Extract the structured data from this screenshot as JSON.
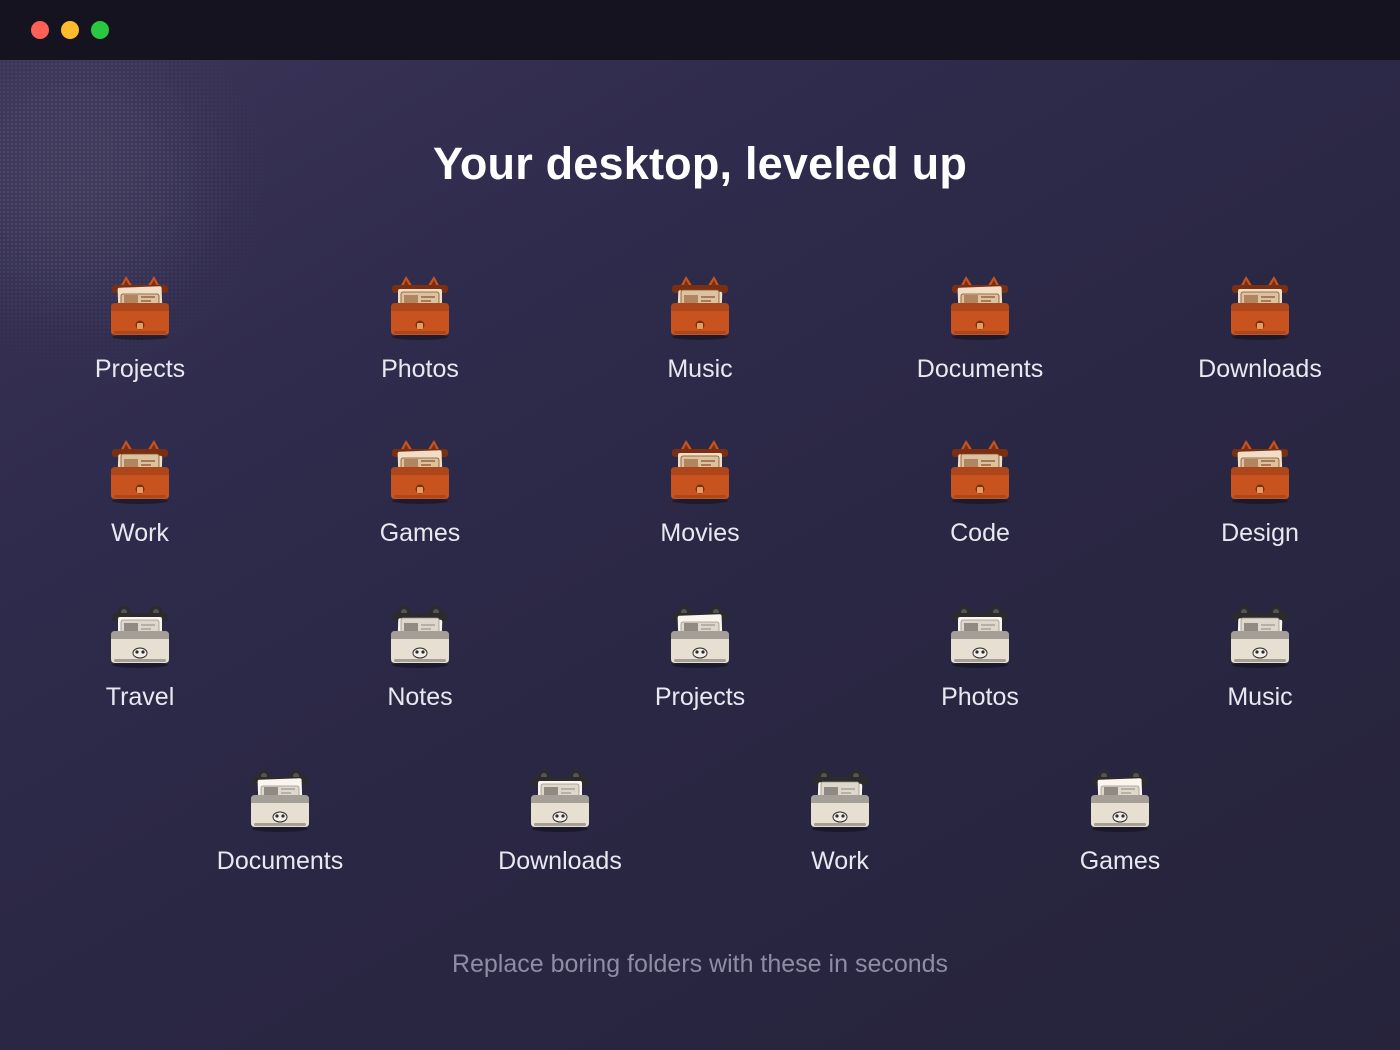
{
  "window": {
    "controls": [
      {
        "name": "close",
        "color": "#fe5f57"
      },
      {
        "name": "minimize",
        "color": "#febb2e"
      },
      {
        "name": "maximize",
        "color": "#28c840"
      }
    ]
  },
  "headline": "Your desktop, leveled up",
  "subtitle": "Replace boring folders with these in seconds",
  "palette": {
    "fox": {
      "body": "#c8531f",
      "dark": "#7a2f12",
      "paper": "#f0dfc6",
      "accent": "#8a4a24"
    },
    "panda": {
      "body": "#e6dfd2",
      "dark": "#2c2b2b",
      "paper": "#faf6ee",
      "accent": "#9b948a"
    }
  },
  "rows": [
    [
      {
        "label": "Projects",
        "icon": "fox-folder-icon",
        "theme": "fox"
      },
      {
        "label": "Photos",
        "icon": "fox-folder-icon",
        "theme": "fox"
      },
      {
        "label": "Music",
        "icon": "fox-folder-icon",
        "theme": "fox"
      },
      {
        "label": "Documents",
        "icon": "fox-folder-icon",
        "theme": "fox"
      },
      {
        "label": "Downloads",
        "icon": "fox-folder-icon",
        "theme": "fox"
      }
    ],
    [
      {
        "label": "Work",
        "icon": "fox-folder-icon",
        "theme": "fox"
      },
      {
        "label": "Games",
        "icon": "fox-folder-icon",
        "theme": "fox"
      },
      {
        "label": "Movies",
        "icon": "fox-folder-icon",
        "theme": "fox"
      },
      {
        "label": "Code",
        "icon": "fox-folder-icon",
        "theme": "fox"
      },
      {
        "label": "Design",
        "icon": "fox-folder-icon",
        "theme": "fox"
      }
    ],
    [
      {
        "label": "Travel",
        "icon": "panda-folder-icon",
        "theme": "panda"
      },
      {
        "label": "Notes",
        "icon": "panda-folder-icon",
        "theme": "panda"
      },
      {
        "label": "Projects",
        "icon": "panda-folder-icon",
        "theme": "panda"
      },
      {
        "label": "Photos",
        "icon": "panda-folder-icon",
        "theme": "panda"
      },
      {
        "label": "Music",
        "icon": "panda-folder-icon",
        "theme": "panda"
      }
    ],
    [
      {
        "label": "Documents",
        "icon": "panda-folder-icon",
        "theme": "panda"
      },
      {
        "label": "Downloads",
        "icon": "panda-folder-icon",
        "theme": "panda"
      },
      {
        "label": "Work",
        "icon": "panda-folder-icon",
        "theme": "panda"
      },
      {
        "label": "Games",
        "icon": "panda-folder-icon",
        "theme": "panda"
      }
    ]
  ]
}
